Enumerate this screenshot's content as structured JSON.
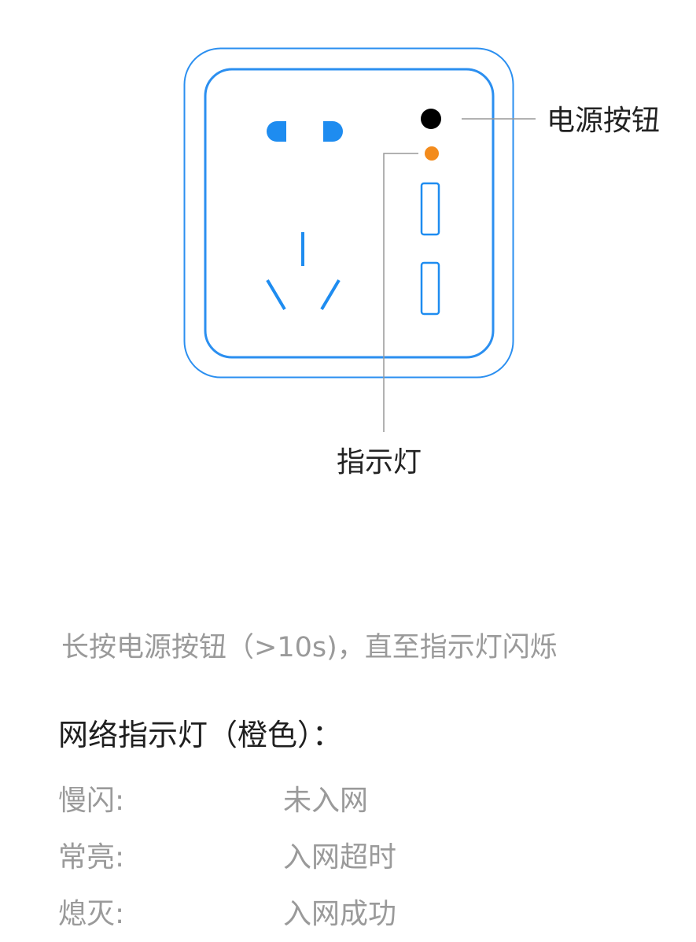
{
  "diagram": {
    "labels": {
      "power_button": "电源按钮",
      "indicator": "指示灯"
    },
    "colors": {
      "outline": "#2b8ff0",
      "socket": "#1e8cf0",
      "power_button": "#000000",
      "indicator_light": "#f38b1c",
      "leader_line": "#999999"
    }
  },
  "instruction": "长按电源按钮（>10s)，直至指示灯闪烁",
  "legend": {
    "title": "网络指示灯（橙色）：",
    "rows": [
      {
        "state": "慢闪:",
        "meaning": "未入网"
      },
      {
        "state": "常亮:",
        "meaning": "入网超时"
      },
      {
        "state": "熄灭:",
        "meaning": "入网成功"
      }
    ]
  }
}
